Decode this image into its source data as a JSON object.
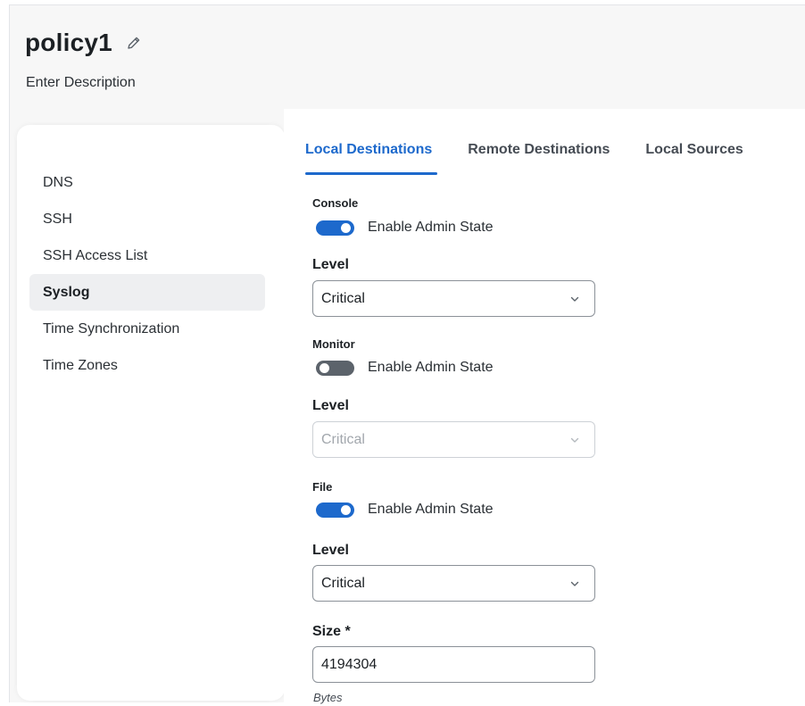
{
  "header": {
    "title": "policy1",
    "description": "Enter Description"
  },
  "sidebar": {
    "items": [
      {
        "label": "DNS",
        "active": false
      },
      {
        "label": "SSH",
        "active": false
      },
      {
        "label": "SSH Access List",
        "active": false
      },
      {
        "label": "Syslog",
        "active": true
      },
      {
        "label": "Time Synchronization",
        "active": false
      },
      {
        "label": "Time Zones",
        "active": false
      }
    ]
  },
  "tabs": [
    {
      "label": "Local Destinations",
      "active": true
    },
    {
      "label": "Remote Destinations",
      "active": false
    },
    {
      "label": "Local Sources",
      "active": false
    }
  ],
  "console": {
    "section_label": "Console",
    "toggle_label": "Enable Admin State",
    "enabled": true,
    "level_label": "Level",
    "level_value": "Critical"
  },
  "monitor": {
    "section_label": "Monitor",
    "toggle_label": "Enable Admin State",
    "enabled": false,
    "level_label": "Level",
    "level_value": "Critical"
  },
  "file": {
    "section_label": "File",
    "toggle_label": "Enable Admin State",
    "enabled": true,
    "level_label": "Level",
    "level_value": "Critical",
    "size_label": "Size *",
    "size_value": "4194304",
    "size_unit": "Bytes"
  },
  "colors": {
    "accent": "#1d69cc",
    "toggle_off": "#5c636b",
    "panel_bg": "#f7f7f7"
  }
}
